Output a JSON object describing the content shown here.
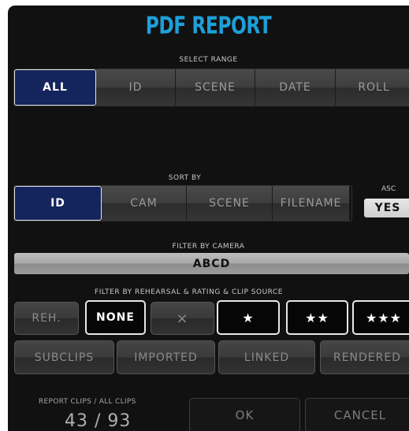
{
  "title": "PDF REPORT",
  "select_range": {
    "label": "SELECT RANGE",
    "options": [
      "ALL",
      "ID",
      "SCENE",
      "DATE",
      "ROLL"
    ],
    "selected": "ALL"
  },
  "sort_by": {
    "label": "SORT BY",
    "options": [
      "ID",
      "CAM",
      "SCENE",
      "FILENAME"
    ],
    "selected": "ID",
    "asc_label": "ASC",
    "asc_value": "YES"
  },
  "filter_camera": {
    "label": "FILTER BY CAMERA",
    "value": "ABCD"
  },
  "filter_rehearsal": {
    "label": "FILTER BY REHEARSAL & RATING & CLIP SOURCE",
    "reh": "REH.",
    "none": "NONE",
    "clear_symbol": "×",
    "ratings": [
      "★",
      "★★",
      "★★★"
    ]
  },
  "clip_source": [
    "SUBCLIPS",
    "IMPORTED",
    "LINKED",
    "RENDERED"
  ],
  "counter": {
    "label": "REPORT CLIPS / ALL CLIPS",
    "value": "43 / 93"
  },
  "actions": {
    "ok": "OK",
    "cancel": "CANCEL"
  },
  "colors": {
    "title": "#1e9fd8",
    "selected": "#14245c",
    "panel": "#111111"
  }
}
